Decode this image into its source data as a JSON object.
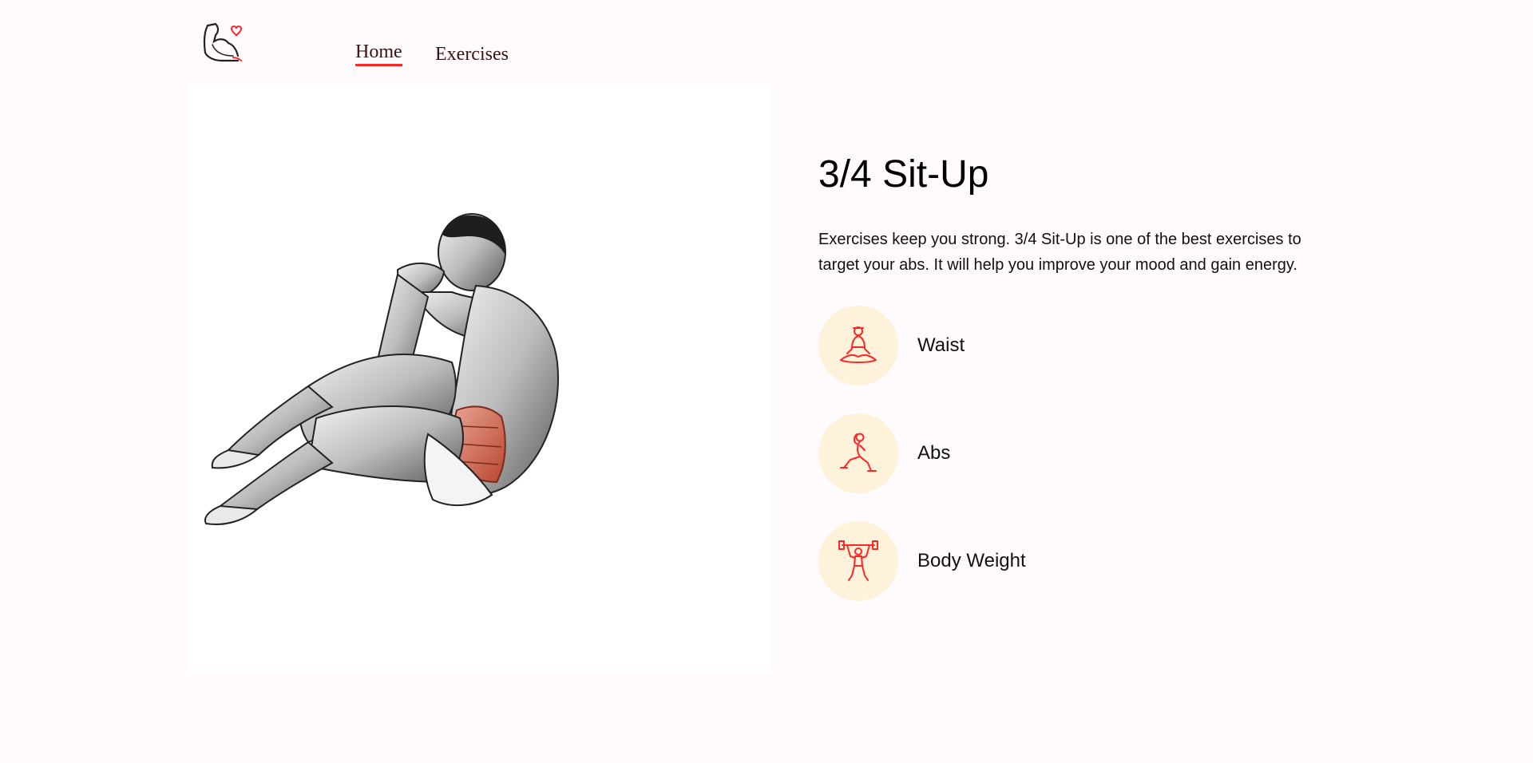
{
  "nav": {
    "logo_icon": "flexed-arm-heart-icon",
    "home_label": "Home",
    "exercises_label": "Exercises",
    "accent_color": "#ff2625"
  },
  "exercise": {
    "image_icon": "anatomy-sit-up-illustration",
    "title": "3/4 Sit-Up",
    "description": "Exercises keep you strong. 3/4 Sit-Up is one of the best exercises to target your abs. It will help you improve your mood and gain energy."
  },
  "tags": [
    {
      "label": "Waist",
      "icon": "meditation-pose-icon"
    },
    {
      "label": "Abs",
      "icon": "lunge-pose-icon"
    },
    {
      "label": "Body Weight",
      "icon": "weightlifter-icon"
    }
  ],
  "colors": {
    "page_background": "#fffafb",
    "tag_circle": "#fff2db",
    "icon_stroke": "#ff2625"
  }
}
